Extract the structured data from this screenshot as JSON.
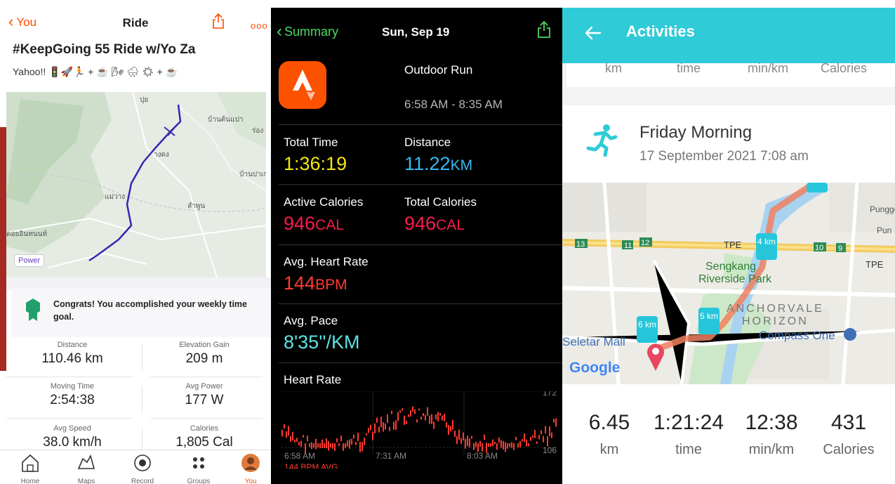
{
  "ride": {
    "back_label": "You",
    "header_title": "Ride",
    "activity_title": "#KeepGoing 55 Ride w/Yo Za",
    "description": "Yahoo!! 🚦🚀🏃 + ☕ 🌬 🌧 ☀ + ☕",
    "map_labels": [
      "ปุย",
      "บ้านต้นแปา",
      "ร่อง",
      "บ้านปาเก",
      "างดง",
      "แม่วาง",
      "ลำพูน",
      "ดอยอินทนนท์"
    ],
    "power_badge": "Power",
    "goal_message": "Congrats! You accomplished your weekly time goal.",
    "stats": [
      {
        "label": "Distance",
        "value": "110.46 km"
      },
      {
        "label": "Elevation Gain",
        "value": "209 m"
      },
      {
        "label": "Moving Time",
        "value": "2:54:38"
      },
      {
        "label": "Avg Power",
        "value": "177 W"
      },
      {
        "label": "Avg Speed",
        "value": "38.0 km/h"
      },
      {
        "label": "Calories",
        "value": "1,805 Cal"
      }
    ],
    "tabs": [
      {
        "label": "Home",
        "icon": "home-icon"
      },
      {
        "label": "Maps",
        "icon": "map-icon"
      },
      {
        "label": "Record",
        "icon": "record-icon"
      },
      {
        "label": "Groups",
        "icon": "groups-icon"
      },
      {
        "label": "You",
        "icon": "avatar"
      }
    ],
    "accent_color": "#fc4c02",
    "route_color": "#3b24b0"
  },
  "summary": {
    "back_label": "Summary",
    "date": "Sun, Sep 19",
    "workout_type": "Outdoor Run",
    "time_range": "6:58 AM - 8:35 AM",
    "metrics": {
      "total_time": {
        "label": "Total Time",
        "value": "1:36:19"
      },
      "distance": {
        "label": "Distance",
        "value": "11.22",
        "unit": "KM"
      },
      "active_calories": {
        "label": "Active Calories",
        "value": "946",
        "unit": "CAL"
      },
      "total_calories": {
        "label": "Total Calories",
        "value": "946",
        "unit": "CAL"
      },
      "avg_heart_rate": {
        "label": "Avg. Heart Rate",
        "value": "144",
        "unit": "BPM"
      },
      "avg_pace": {
        "label": "Avg. Pace",
        "value": "8'35''/KM"
      }
    },
    "heart_rate_chart": {
      "title": "Heart Rate",
      "y_max": "172",
      "y_min": "106",
      "x_labels": [
        "6:58 AM",
        "7:31 AM",
        "8:03 AM"
      ],
      "avg_label": "144 BPM AVG"
    },
    "colors": {
      "time": "#f5e50a",
      "distance": "#37b9f1",
      "calories": "#fa1b4b",
      "heart": "#ff3b30",
      "pace": "#5de3e3"
    }
  },
  "activities": {
    "header_title": "Activities",
    "prev_units": [
      "km",
      "time",
      "min/km",
      "Calories"
    ],
    "activity_name": "Friday Morning",
    "activity_datetime": "17 September 2021 7:08 am",
    "map_labels": {
      "tpe": "TPE",
      "sengkang": "Sengkang",
      "park": "Riverside Park",
      "anchorvale": "ANCHORVALE",
      "horizon": "HORIZON",
      "compass": "Compass One",
      "seletar": "Seletar Mall",
      "punggol": "Punggo",
      "pun": "Pun",
      "google": "Google",
      "km_markers": [
        "4 km",
        "5 km",
        "6 km"
      ],
      "road_numbers": [
        "13",
        "11",
        "12",
        "10",
        "9"
      ]
    },
    "stats": [
      {
        "value": "6.45",
        "unit": "km"
      },
      {
        "value": "1:21:24",
        "unit": "time"
      },
      {
        "value": "12:38",
        "unit": "min/km"
      },
      {
        "value": "431",
        "unit": "Calories"
      }
    ],
    "header_color": "#2fcbd7",
    "route_color": "#f08060"
  }
}
